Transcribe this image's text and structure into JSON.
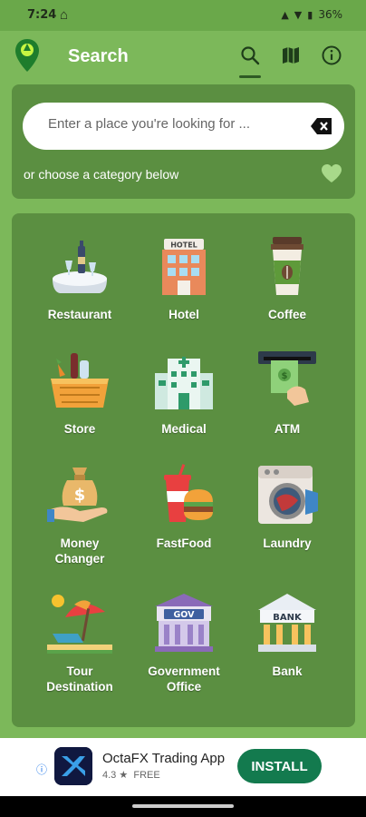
{
  "status_bar": {
    "time": "7:24",
    "battery": "36%"
  },
  "app_bar": {
    "title": "Search"
  },
  "search": {
    "placeholder": "Enter a place you're looking for ...",
    "hint": "or choose a category below"
  },
  "categories": [
    {
      "label_lines": [
        "Restaurant"
      ]
    },
    {
      "label_lines": [
        "Hotel"
      ]
    },
    {
      "label_lines": [
        "Coffee"
      ]
    },
    {
      "label_lines": [
        "Store"
      ]
    },
    {
      "label_lines": [
        "Medical"
      ]
    },
    {
      "label_lines": [
        "ATM"
      ]
    },
    {
      "label_lines": [
        "Money",
        "Changer"
      ]
    },
    {
      "label_lines": [
        "FastFood"
      ]
    },
    {
      "label_lines": [
        "Laundry"
      ]
    },
    {
      "label_lines": [
        "Tour",
        "Destination"
      ]
    },
    {
      "label_lines": [
        "Government",
        "Office"
      ]
    },
    {
      "label_lines": [
        "Bank"
      ]
    }
  ],
  "tile_text": {
    "hotel": "HOTEL",
    "gov": "GOV",
    "bank": "BANK"
  },
  "ad": {
    "title": "OctaFX Trading App",
    "rating": "4.3 ★",
    "price": "FREE",
    "install_label": "INSTALL"
  },
  "colors": {
    "background": "#7cb85a",
    "card": "#5b8f41",
    "install": "#137a4e"
  }
}
